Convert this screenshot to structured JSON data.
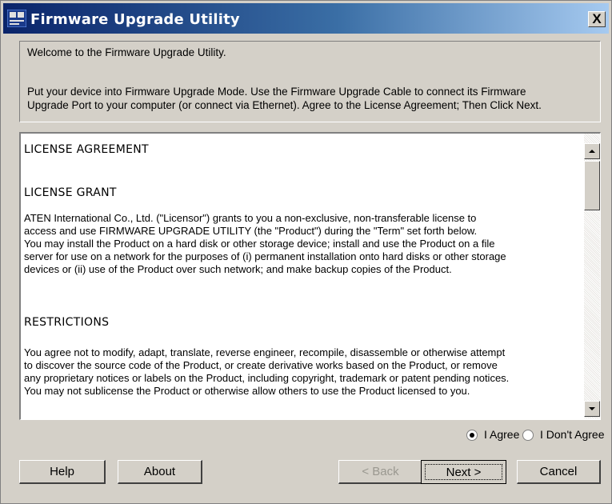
{
  "window": {
    "title": "Firmware Upgrade Utility",
    "close_label": "X"
  },
  "info": {
    "welcome": "Welcome to the Firmware Upgrade Utility.",
    "instruction_line1": "Put your device into Firmware Upgrade Mode. Use the Firmware Upgrade Cable to connect its Firmware",
    "instruction_line2": "Upgrade Port to your computer (or connect via Ethernet). Agree to the License Agreement; Then Click Next."
  },
  "license": {
    "heading": "LICENSE AGREEMENT",
    "grant_heading": "LICENSE GRANT",
    "grant_lines": [
      "ATEN International Co., Ltd. (\"Licensor\") grants to you a non-exclusive, non-transferable license to",
      "access and use FIRMWARE UPGRADE UTILITY (the \"Product\") during the \"Term\" set forth below.",
      "You may install the Product on a hard disk or other storage device; install and use the Product on a file",
      "server for use on a network for the purposes of (i) permanent installation onto hard disks or other storage",
      "devices or (ii) use of the Product over such network; and make backup copies of the Product."
    ],
    "restrictions_heading": "RESTRICTIONS",
    "restrictions_lines": [
      "You agree not to modify, adapt, translate, reverse engineer, recompile, disassemble or otherwise attempt",
      "to discover the source code of the Product, or create derivative works based on the Product, or remove",
      "any proprietary notices or labels on the Product, including copyright, trademark or patent pending notices.",
      "You may not sublicense the Product or otherwise allow others to use the Product licensed to you."
    ]
  },
  "agreement": {
    "agree_label": "I Agree",
    "disagree_label": "I Don't Agree",
    "selected": "I Agree"
  },
  "buttons": {
    "help": "Help",
    "about": "About",
    "back": "< Back",
    "next": "Next >",
    "cancel": "Cancel"
  },
  "icons": {
    "scroll_up": "triangle-up-icon",
    "scroll_down": "triangle-down-icon",
    "app": "firmware-utility-icon"
  }
}
